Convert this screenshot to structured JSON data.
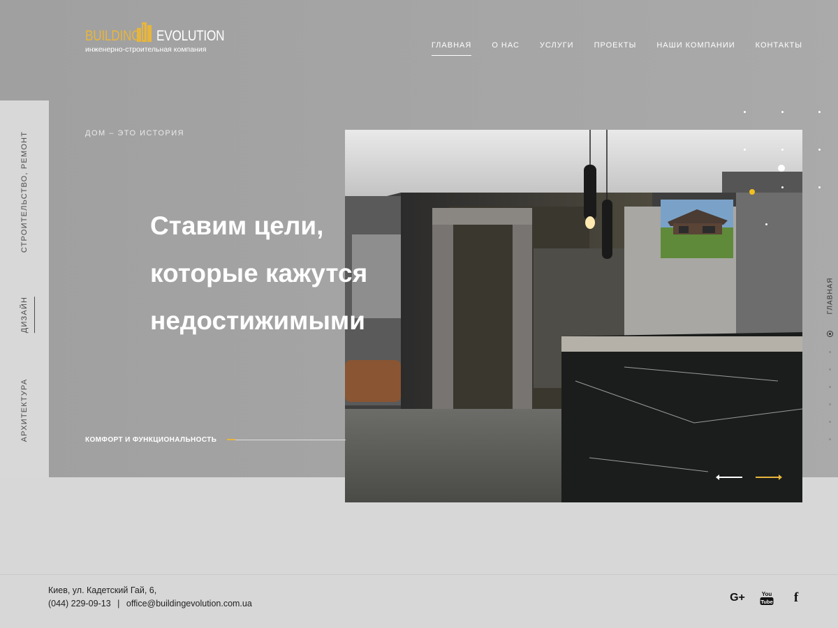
{
  "logo": {
    "word1": "BUILDING",
    "word2": "EVOLUTION",
    "tagline": "инженерно-строительная компания",
    "accent_color": "#e8b53c"
  },
  "nav": {
    "items": [
      {
        "label": "ГЛАВНАЯ",
        "active": true
      },
      {
        "label": "О НАС"
      },
      {
        "label": "УСЛУГИ"
      },
      {
        "label": "ПРОЕКТЫ"
      },
      {
        "label": "НАШИ КОМПАНИИ"
      },
      {
        "label": "КОНТАКТЫ"
      }
    ]
  },
  "side_nav": {
    "items": [
      {
        "label": "СТРОИТЕЛЬСТВО, РЕМОНТ"
      },
      {
        "label": "ДИЗАЙН",
        "active": true
      },
      {
        "label": "АРХИТЕКТУРА"
      }
    ]
  },
  "hero": {
    "eyebrow": "ДОМ – ЭТО ИСТОРИЯ",
    "headline_lines": [
      "Ставим цели,",
      "которые кажутся",
      "недостижимыми"
    ],
    "bottom_tag": "КОМФОРТ И ФУНКЦИОНАЛЬНОСТЬ"
  },
  "right_nav": {
    "label": "ГЛАВНАЯ"
  },
  "footer": {
    "address": "Киев, ул. Кадетский Гай, 6,",
    "phone": "(044) 229-09-13",
    "separator": "|",
    "email": "office@buildingevolution.com.ua",
    "social": [
      {
        "icon": "google-plus-icon",
        "glyph": "G+"
      },
      {
        "icon": "youtube-icon",
        "glyph_top": "You",
        "glyph_bottom": "Tube"
      },
      {
        "icon": "facebook-icon",
        "glyph": "f"
      }
    ]
  }
}
